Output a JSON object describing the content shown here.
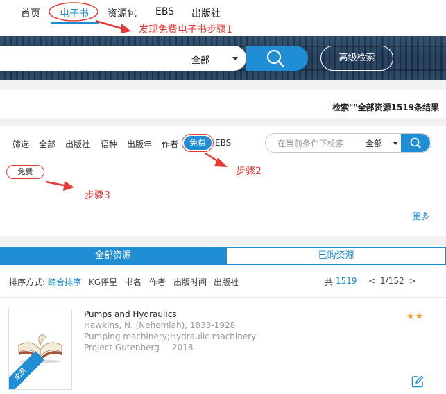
{
  "nav": {
    "items": [
      "首页",
      "电子书",
      "资源包",
      "EBS",
      "出版社"
    ],
    "active_index": 1
  },
  "search": {
    "scope": "全部",
    "advanced_label": "高级检索"
  },
  "result_summary": "检索\"\"全部资源1519条结果",
  "filters": {
    "items": [
      "筛选",
      "全部",
      "出版社",
      "语种",
      "出版年",
      "作者",
      "免费",
      "EBS"
    ],
    "active_index": 6,
    "search_placeholder": "在当前条件下检索",
    "search_scope": "全部",
    "selected_tag": "免费",
    "more_label": "更多"
  },
  "tabs": {
    "active": "全部资源",
    "inactive": "已购资源"
  },
  "sort": {
    "label": "排序方式:",
    "options": [
      "综合排序",
      "KG评星",
      "书名",
      "作者",
      "出版时间",
      "出版社"
    ],
    "active_index": 0
  },
  "pager": {
    "total_prefix": "共",
    "total": "1519",
    "prev": "<",
    "page": "1/152",
    "next": ">"
  },
  "book": {
    "title": "Pumps and Hydraulics",
    "author": "Hawkins, N. (Nehemiah), 1833-1928",
    "subjects": "Pumping machinery;Hydraulic machinery",
    "publisher": "Project Gutenberg",
    "year": "2018",
    "cover_ribbon": "免费",
    "rating_stars": 2,
    "stars": "★★"
  },
  "annotations": {
    "step1": "发现免费电子书步骤1",
    "step2": "步骤2",
    "step3": "步骤3"
  },
  "colors": {
    "accent": "#1f8ed4",
    "annotation": "#e53935",
    "star": "#f0a020"
  }
}
